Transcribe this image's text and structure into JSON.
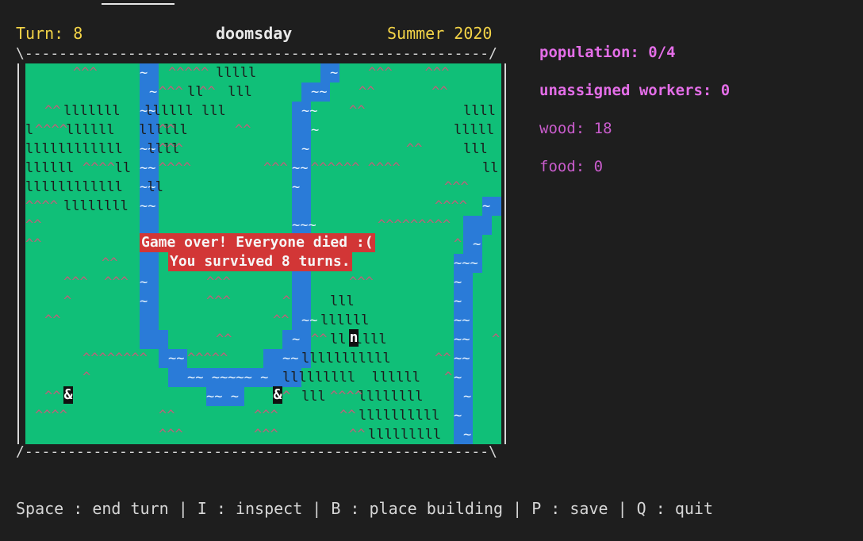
{
  "header": {
    "turn": "Turn: 8",
    "title": "doomsday",
    "season": "Summer 2020"
  },
  "frame": {
    "top": "\\------------------------------------------------------/",
    "bottom": "/------------------------------------------------------\\"
  },
  "banner": {
    "line1": "Game over! Everyone died :(",
    "line2": "You survived 8 turns."
  },
  "units": {
    "settler_a": "&",
    "settler_b": "&",
    "npc": "n"
  },
  "stats": {
    "population": "population: 0/4",
    "unassigned": "unassigned workers: 0",
    "wood": "wood: 18",
    "food": "food: 0"
  },
  "footer": {
    "help": "Space : end turn | I : inspect | B : place building | P : save | Q : quit"
  },
  "colors": {
    "grass": "#10bf78",
    "water": "#2a7bd8",
    "banner": "#d23636",
    "header": "#f2d347",
    "stats": "#e46ee8"
  }
}
